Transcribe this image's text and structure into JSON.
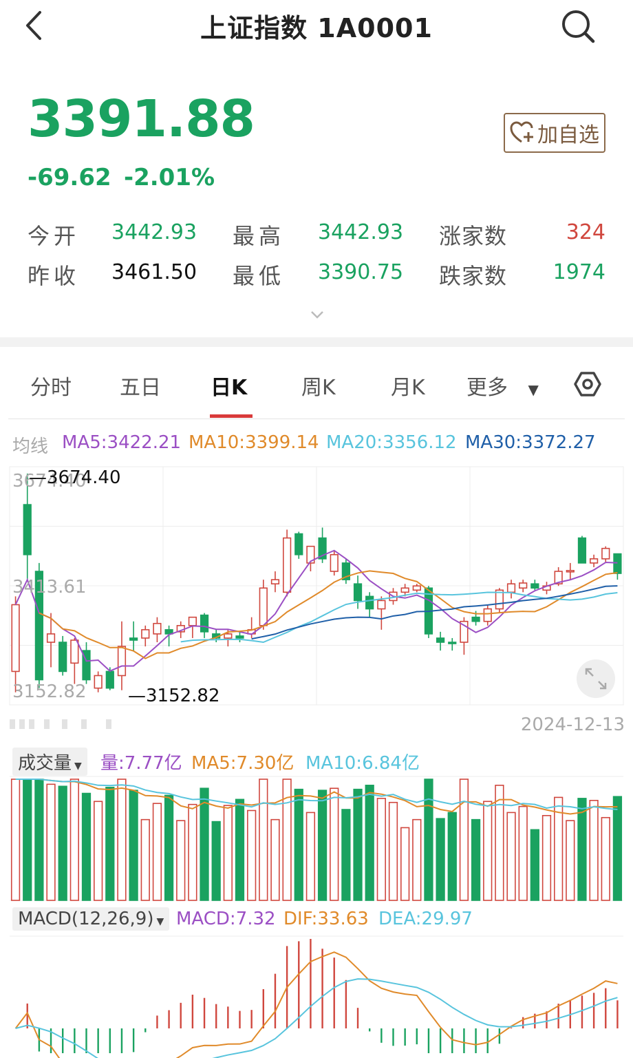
{
  "header": {
    "title": "上证指数 1A0001",
    "back_icon": "chevron-left-icon",
    "search_icon": "search-icon"
  },
  "quote": {
    "price": "3391.88",
    "change": "-69.62",
    "change_pct": "-2.01%"
  },
  "add_favorite": {
    "label": "加自选",
    "icon": "heart-plus-icon"
  },
  "stats": [
    {
      "label": "今开",
      "value": "3442.93",
      "color": "#1aa260"
    },
    {
      "label": "最高",
      "value": "3442.93",
      "color": "#1aa260"
    },
    {
      "label": "涨家数",
      "value": "324",
      "color": "#d0473e"
    },
    {
      "label": "昨收",
      "value": "3461.50",
      "color": "#111111"
    },
    {
      "label": "最低",
      "value": "3390.75",
      "color": "#1aa260"
    },
    {
      "label": "跌家数",
      "value": "1974",
      "color": "#1aa260"
    }
  ],
  "tabs": [
    "分时",
    "五日",
    "日K",
    "周K",
    "月K",
    "更多"
  ],
  "active_tab": "日K",
  "ma": {
    "label": "均线",
    "ma5": "MA5:3422.21",
    "ma10": "MA10:3399.14",
    "ma20": "MA20:3356.12",
    "ma30": "MA30:3372.27"
  },
  "kline": {
    "axis_high": "3674.40",
    "axis_mid": "3413.61",
    "axis_low": "3152.82",
    "max_label": "3674.40",
    "min_label": "3152.82",
    "date": "2024-12-13"
  },
  "volume": {
    "selector": "成交量",
    "vol": "量:7.77亿",
    "ma5": "MA5:7.30亿",
    "ma10": "MA10:6.84亿"
  },
  "macd": {
    "selector": "MACD(12,26,9)",
    "macd": "MACD:7.32",
    "dif": "DIF:33.63",
    "dea": "DEA:29.97"
  },
  "colors": {
    "up": "#d0473e",
    "down": "#1aa260",
    "ma5": "#9b4fc4",
    "ma10": "#e08a2a",
    "ma20": "#58c4dd",
    "ma30": "#1f5fa8"
  },
  "chart_data": {
    "type": "candlestick",
    "ylim": [
      3152.82,
      3674.4
    ],
    "x_end": "2024-12-13",
    "candles": [
      {
        "o": 3200,
        "h": 3380,
        "l": 3150,
        "c": 3360
      },
      {
        "o": 3600,
        "h": 3674.4,
        "l": 3420,
        "c": 3480
      },
      {
        "o": 3440,
        "h": 3460,
        "l": 3160,
        "c": 3180
      },
      {
        "o": 3270,
        "h": 3340,
        "l": 3210,
        "c": 3290
      },
      {
        "o": 3270,
        "h": 3285,
        "l": 3190,
        "c": 3200
      },
      {
        "o": 3220,
        "h": 3280,
        "l": 3170,
        "c": 3275
      },
      {
        "o": 3250,
        "h": 3270,
        "l": 3170,
        "c": 3180
      },
      {
        "o": 3160,
        "h": 3200,
        "l": 3150,
        "c": 3190
      },
      {
        "o": 3200,
        "h": 3210,
        "l": 3155,
        "c": 3160
      },
      {
        "o": 3190,
        "h": 3320,
        "l": 3155,
        "c": 3260
      },
      {
        "o": 3280,
        "h": 3320,
        "l": 3250,
        "c": 3275
      },
      {
        "o": 3280,
        "h": 3310,
        "l": 3260,
        "c": 3300
      },
      {
        "o": 3290,
        "h": 3330,
        "l": 3270,
        "c": 3315
      },
      {
        "o": 3300,
        "h": 3310,
        "l": 3260,
        "c": 3290
      },
      {
        "o": 3295,
        "h": 3320,
        "l": 3280,
        "c": 3310
      },
      {
        "o": 3310,
        "h": 3330,
        "l": 3280,
        "c": 3330
      },
      {
        "o": 3335,
        "h": 3340,
        "l": 3280,
        "c": 3295
      },
      {
        "o": 3290,
        "h": 3300,
        "l": 3270,
        "c": 3280
      },
      {
        "o": 3280,
        "h": 3300,
        "l": 3260,
        "c": 3290
      },
      {
        "o": 3285,
        "h": 3295,
        "l": 3270,
        "c": 3280
      },
      {
        "o": 3290,
        "h": 3330,
        "l": 3280,
        "c": 3300
      },
      {
        "o": 3310,
        "h": 3420,
        "l": 3300,
        "c": 3400
      },
      {
        "o": 3410,
        "h": 3440,
        "l": 3390,
        "c": 3420
      },
      {
        "o": 3390,
        "h": 3540,
        "l": 3380,
        "c": 3520
      },
      {
        "o": 3530,
        "h": 3535,
        "l": 3470,
        "c": 3480
      },
      {
        "o": 3460,
        "h": 3500,
        "l": 3440,
        "c": 3500
      },
      {
        "o": 3520,
        "h": 3545,
        "l": 3460,
        "c": 3470
      },
      {
        "o": 3440,
        "h": 3490,
        "l": 3430,
        "c": 3480
      },
      {
        "o": 3460,
        "h": 3470,
        "l": 3410,
        "c": 3420
      },
      {
        "o": 3410,
        "h": 3430,
        "l": 3350,
        "c": 3370
      },
      {
        "o": 3380,
        "h": 3390,
        "l": 3330,
        "c": 3350
      },
      {
        "o": 3350,
        "h": 3380,
        "l": 3300,
        "c": 3370
      },
      {
        "o": 3370,
        "h": 3400,
        "l": 3360,
        "c": 3390
      },
      {
        "o": 3390,
        "h": 3410,
        "l": 3380,
        "c": 3400
      },
      {
        "o": 3395,
        "h": 3410,
        "l": 3390,
        "c": 3405
      },
      {
        "o": 3400,
        "h": 3405,
        "l": 3280,
        "c": 3290
      },
      {
        "o": 3280,
        "h": 3295,
        "l": 3250,
        "c": 3270
      },
      {
        "o": 3270,
        "h": 3280,
        "l": 3250,
        "c": 3268
      },
      {
        "o": 3270,
        "h": 3330,
        "l": 3240,
        "c": 3320
      },
      {
        "o": 3330,
        "h": 3345,
        "l": 3310,
        "c": 3320
      },
      {
        "o": 3320,
        "h": 3360,
        "l": 3310,
        "c": 3350
      },
      {
        "o": 3350,
        "h": 3400,
        "l": 3340,
        "c": 3395
      },
      {
        "o": 3390,
        "h": 3420,
        "l": 3375,
        "c": 3410
      },
      {
        "o": 3400,
        "h": 3420,
        "l": 3390,
        "c": 3412
      },
      {
        "o": 3410,
        "h": 3420,
        "l": 3395,
        "c": 3400
      },
      {
        "o": 3395,
        "h": 3415,
        "l": 3385,
        "c": 3405
      },
      {
        "o": 3410,
        "h": 3450,
        "l": 3405,
        "c": 3440
      },
      {
        "o": 3440,
        "h": 3460,
        "l": 3420,
        "c": 3442
      },
      {
        "o": 3520,
        "h": 3525,
        "l": 3460,
        "c": 3460
      },
      {
        "o": 3460,
        "h": 3480,
        "l": 3450,
        "c": 3470
      },
      {
        "o": 3470,
        "h": 3500,
        "l": 3460,
        "c": 3495
      },
      {
        "o": 3482,
        "h": 3482,
        "l": 3420,
        "c": 3435
      }
    ]
  }
}
